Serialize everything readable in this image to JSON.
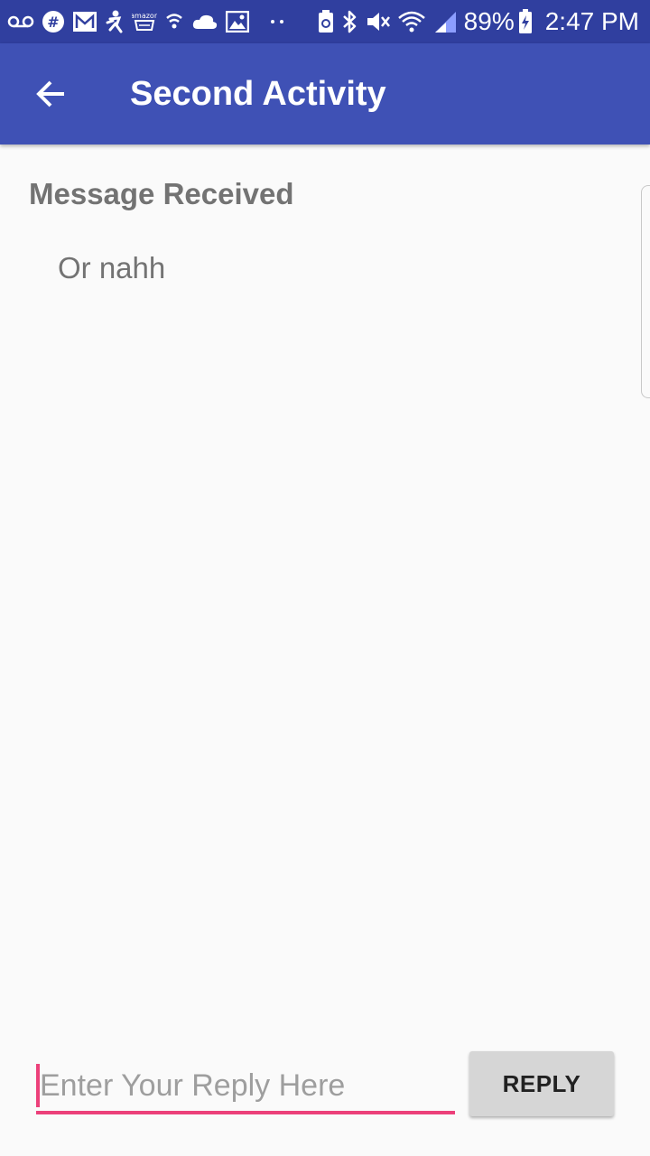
{
  "status_bar": {
    "left_icons": [
      "voicemail-icon",
      "slack-icon",
      "gmail-icon",
      "fitness-icon",
      "amazon-icon",
      "vpn-shield-icon",
      "cloud-icon",
      "gallery-icon",
      "more-dots-icon"
    ],
    "right_icons": [
      "battery-saver-icon",
      "bluetooth-icon",
      "vibrate-mute-icon",
      "wifi-icon",
      "signal-icon",
      "battery-icon"
    ],
    "battery_percent": "89%",
    "time": "2:47 PM",
    "color": "#303f9f"
  },
  "toolbar": {
    "title": "Second Activity",
    "back_icon": "arrow-back-icon",
    "color": "#3f51b5"
  },
  "content": {
    "header": "Message Received",
    "message": "Or nahh"
  },
  "reply": {
    "input_value": "",
    "input_placeholder": "Enter Your Reply Here",
    "button_label": "REPLY",
    "accent_color": "#ec407a"
  }
}
